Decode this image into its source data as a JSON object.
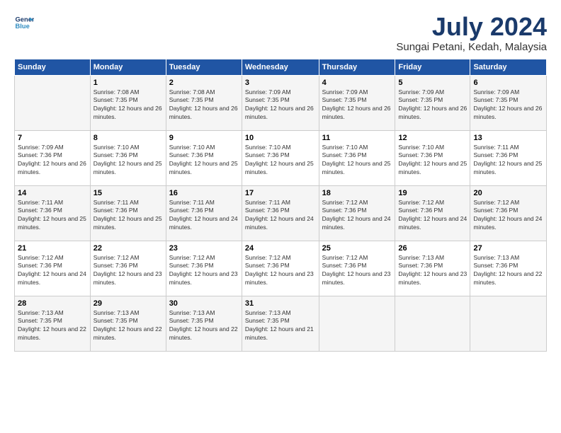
{
  "logo": {
    "line1": "General",
    "line2": "Blue"
  },
  "title": "July 2024",
  "subtitle": "Sungai Petani, Kedah, Malaysia",
  "days_of_week": [
    "Sunday",
    "Monday",
    "Tuesday",
    "Wednesday",
    "Thursday",
    "Friday",
    "Saturday"
  ],
  "weeks": [
    [
      {
        "day": "",
        "sunrise": "",
        "sunset": "",
        "daylight": "",
        "empty": true
      },
      {
        "day": "1",
        "sunrise": "Sunrise: 7:08 AM",
        "sunset": "Sunset: 7:35 PM",
        "daylight": "Daylight: 12 hours and 26 minutes."
      },
      {
        "day": "2",
        "sunrise": "Sunrise: 7:08 AM",
        "sunset": "Sunset: 7:35 PM",
        "daylight": "Daylight: 12 hours and 26 minutes."
      },
      {
        "day": "3",
        "sunrise": "Sunrise: 7:09 AM",
        "sunset": "Sunset: 7:35 PM",
        "daylight": "Daylight: 12 hours and 26 minutes."
      },
      {
        "day": "4",
        "sunrise": "Sunrise: 7:09 AM",
        "sunset": "Sunset: 7:35 PM",
        "daylight": "Daylight: 12 hours and 26 minutes."
      },
      {
        "day": "5",
        "sunrise": "Sunrise: 7:09 AM",
        "sunset": "Sunset: 7:35 PM",
        "daylight": "Daylight: 12 hours and 26 minutes."
      },
      {
        "day": "6",
        "sunrise": "Sunrise: 7:09 AM",
        "sunset": "Sunset: 7:35 PM",
        "daylight": "Daylight: 12 hours and 26 minutes."
      }
    ],
    [
      {
        "day": "7",
        "sunrise": "Sunrise: 7:09 AM",
        "sunset": "Sunset: 7:36 PM",
        "daylight": "Daylight: 12 hours and 26 minutes."
      },
      {
        "day": "8",
        "sunrise": "Sunrise: 7:10 AM",
        "sunset": "Sunset: 7:36 PM",
        "daylight": "Daylight: 12 hours and 25 minutes."
      },
      {
        "day": "9",
        "sunrise": "Sunrise: 7:10 AM",
        "sunset": "Sunset: 7:36 PM",
        "daylight": "Daylight: 12 hours and 25 minutes."
      },
      {
        "day": "10",
        "sunrise": "Sunrise: 7:10 AM",
        "sunset": "Sunset: 7:36 PM",
        "daylight": "Daylight: 12 hours and 25 minutes."
      },
      {
        "day": "11",
        "sunrise": "Sunrise: 7:10 AM",
        "sunset": "Sunset: 7:36 PM",
        "daylight": "Daylight: 12 hours and 25 minutes."
      },
      {
        "day": "12",
        "sunrise": "Sunrise: 7:10 AM",
        "sunset": "Sunset: 7:36 PM",
        "daylight": "Daylight: 12 hours and 25 minutes."
      },
      {
        "day": "13",
        "sunrise": "Sunrise: 7:11 AM",
        "sunset": "Sunset: 7:36 PM",
        "daylight": "Daylight: 12 hours and 25 minutes."
      }
    ],
    [
      {
        "day": "14",
        "sunrise": "Sunrise: 7:11 AM",
        "sunset": "Sunset: 7:36 PM",
        "daylight": "Daylight: 12 hours and 25 minutes."
      },
      {
        "day": "15",
        "sunrise": "Sunrise: 7:11 AM",
        "sunset": "Sunset: 7:36 PM",
        "daylight": "Daylight: 12 hours and 25 minutes."
      },
      {
        "day": "16",
        "sunrise": "Sunrise: 7:11 AM",
        "sunset": "Sunset: 7:36 PM",
        "daylight": "Daylight: 12 hours and 24 minutes."
      },
      {
        "day": "17",
        "sunrise": "Sunrise: 7:11 AM",
        "sunset": "Sunset: 7:36 PM",
        "daylight": "Daylight: 12 hours and 24 minutes."
      },
      {
        "day": "18",
        "sunrise": "Sunrise: 7:12 AM",
        "sunset": "Sunset: 7:36 PM",
        "daylight": "Daylight: 12 hours and 24 minutes."
      },
      {
        "day": "19",
        "sunrise": "Sunrise: 7:12 AM",
        "sunset": "Sunset: 7:36 PM",
        "daylight": "Daylight: 12 hours and 24 minutes."
      },
      {
        "day": "20",
        "sunrise": "Sunrise: 7:12 AM",
        "sunset": "Sunset: 7:36 PM",
        "daylight": "Daylight: 12 hours and 24 minutes."
      }
    ],
    [
      {
        "day": "21",
        "sunrise": "Sunrise: 7:12 AM",
        "sunset": "Sunset: 7:36 PM",
        "daylight": "Daylight: 12 hours and 24 minutes."
      },
      {
        "day": "22",
        "sunrise": "Sunrise: 7:12 AM",
        "sunset": "Sunset: 7:36 PM",
        "daylight": "Daylight: 12 hours and 23 minutes."
      },
      {
        "day": "23",
        "sunrise": "Sunrise: 7:12 AM",
        "sunset": "Sunset: 7:36 PM",
        "daylight": "Daylight: 12 hours and 23 minutes."
      },
      {
        "day": "24",
        "sunrise": "Sunrise: 7:12 AM",
        "sunset": "Sunset: 7:36 PM",
        "daylight": "Daylight: 12 hours and 23 minutes."
      },
      {
        "day": "25",
        "sunrise": "Sunrise: 7:12 AM",
        "sunset": "Sunset: 7:36 PM",
        "daylight": "Daylight: 12 hours and 23 minutes."
      },
      {
        "day": "26",
        "sunrise": "Sunrise: 7:13 AM",
        "sunset": "Sunset: 7:36 PM",
        "daylight": "Daylight: 12 hours and 23 minutes."
      },
      {
        "day": "27",
        "sunrise": "Sunrise: 7:13 AM",
        "sunset": "Sunset: 7:36 PM",
        "daylight": "Daylight: 12 hours and 22 minutes."
      }
    ],
    [
      {
        "day": "28",
        "sunrise": "Sunrise: 7:13 AM",
        "sunset": "Sunset: 7:35 PM",
        "daylight": "Daylight: 12 hours and 22 minutes."
      },
      {
        "day": "29",
        "sunrise": "Sunrise: 7:13 AM",
        "sunset": "Sunset: 7:35 PM",
        "daylight": "Daylight: 12 hours and 22 minutes."
      },
      {
        "day": "30",
        "sunrise": "Sunrise: 7:13 AM",
        "sunset": "Sunset: 7:35 PM",
        "daylight": "Daylight: 12 hours and 22 minutes."
      },
      {
        "day": "31",
        "sunrise": "Sunrise: 7:13 AM",
        "sunset": "Sunset: 7:35 PM",
        "daylight": "Daylight: 12 hours and 21 minutes."
      },
      {
        "day": "",
        "sunrise": "",
        "sunset": "",
        "daylight": "",
        "empty": true
      },
      {
        "day": "",
        "sunrise": "",
        "sunset": "",
        "daylight": "",
        "empty": true
      },
      {
        "day": "",
        "sunrise": "",
        "sunset": "",
        "daylight": "",
        "empty": true
      }
    ]
  ]
}
